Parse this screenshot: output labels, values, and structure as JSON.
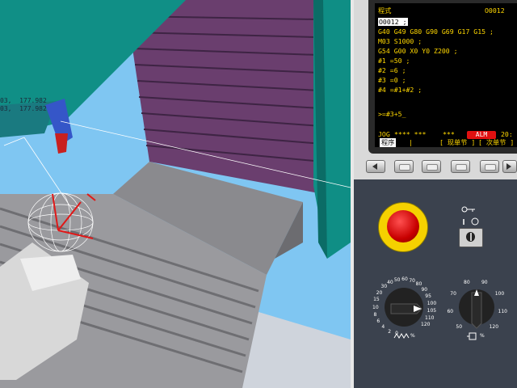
{
  "viewport": {
    "coord_readout_1": "03,  177.982",
    "coord_readout_2": "03,  177.982"
  },
  "cnc": {
    "screen": {
      "header_left": "程式",
      "header_right": "O0012",
      "lines": [
        "O0012 ;",
        "G40 G49 G80 G90 G69 G17 G15 ;",
        "M03 S1000 ;",
        "G54 G00 X0 Y0 Z200 ;",
        "#1 =50 ;",
        "#2 =6 ;",
        "#3 =0 ;",
        "#4 =#1+#2 ;"
      ],
      "input": ">=#3+5_",
      "status_mode": "JOG",
      "status_stars": "**** ***",
      "status_dashes": "***",
      "alarm": "ALM",
      "time": "20:",
      "softkey_1": "程序",
      "softkey_sep": "|",
      "softkey_2": "[ 现单节 ]",
      "softkey_3": "[ 次单节 ]"
    },
    "accent_colors": {
      "screen_text": "#ffd700",
      "alarm": "#e01010",
      "panel": "#3b424e",
      "estop_ring": "#f5d100"
    },
    "icons": {
      "key_switch": "key-icon",
      "feed_override": "feed-override-icon",
      "spindle_override": "spindle-override-icon"
    },
    "feed_dial": {
      "scale": [
        "0",
        "2",
        "4",
        "6",
        "8",
        "10",
        "15",
        "20",
        "30",
        "40",
        "50",
        "60",
        "70",
        "80",
        "90",
        "95",
        "100",
        "105",
        "110",
        "120"
      ],
      "unit": "%"
    },
    "spindle_dial": {
      "scale": [
        "50",
        "60",
        "70",
        "80",
        "90",
        "100",
        "110",
        "120"
      ],
      "unit": "%"
    }
  }
}
